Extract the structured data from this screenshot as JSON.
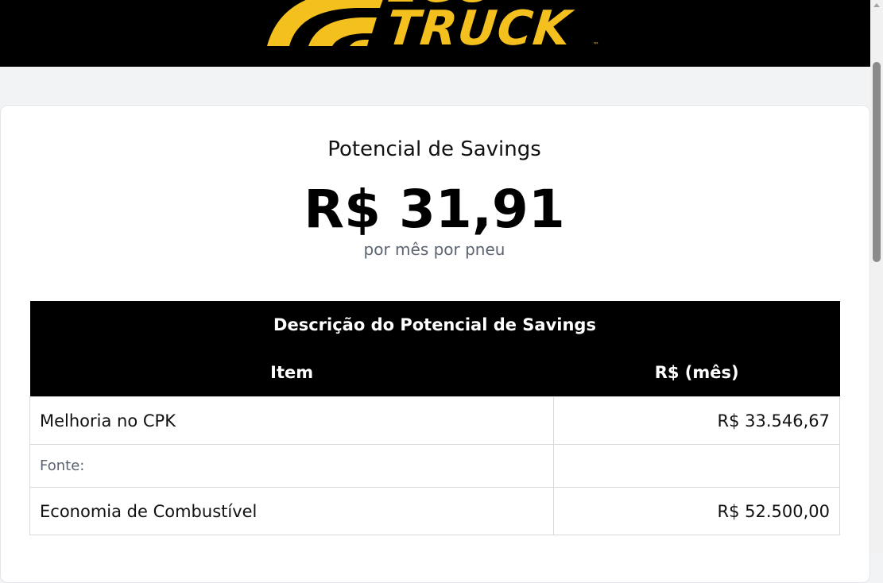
{
  "header": {
    "logo_text_top": "ECO",
    "logo_text": "TRUCK",
    "logo_tm": "™"
  },
  "summary": {
    "title": "Potencial de Savings",
    "amount": "R$ 31,91",
    "subtitle": "por mês por pneu"
  },
  "table": {
    "caption": "Descrição do Potencial de Savings",
    "columns": [
      "Item",
      "R$ (mês)"
    ],
    "rows": [
      {
        "item": "Melhoria no CPK",
        "value": "R$ 33.546,67"
      },
      {
        "item": "Fonte:",
        "value": ""
      },
      {
        "item": "Economia de Combustível",
        "value": "R$ 52.500,00"
      }
    ]
  },
  "colors": {
    "brand_yellow": "#f4c01e",
    "header_bg": "#000000",
    "page_bg": "#f2f3f5"
  }
}
